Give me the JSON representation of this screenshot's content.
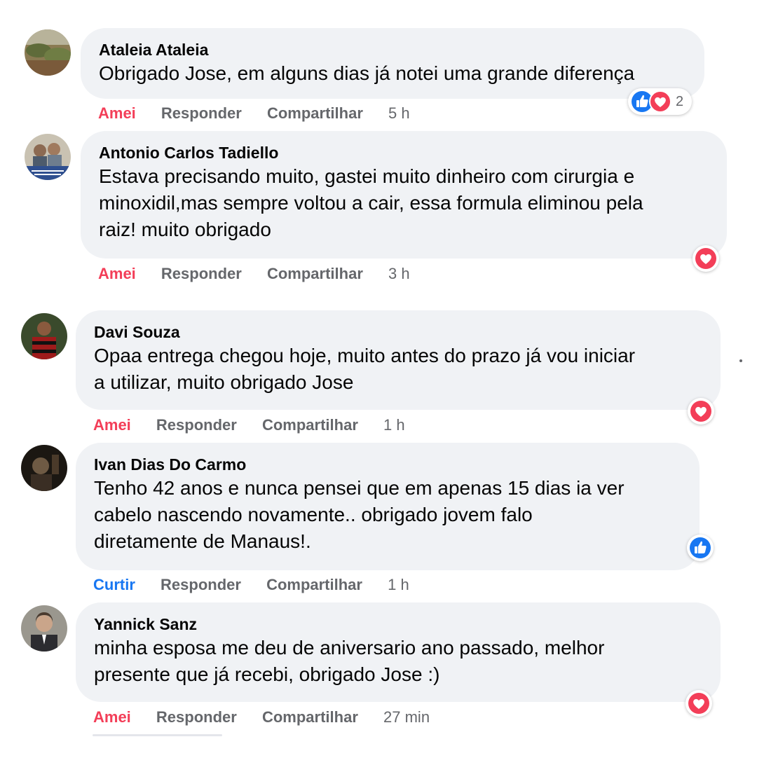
{
  "comments": [
    {
      "author": "Ataleia Ataleia",
      "text_lines": [
        "Obrigado Jose, em alguns dias já notei uma grande diferença"
      ],
      "action_react": "Amei",
      "action_reply": "Responder",
      "action_share": "Compartilhar",
      "time": "5 h",
      "reaction_count": "2",
      "reaction_icons": [
        "like-icon",
        "love-icon"
      ],
      "avatar": "landscape-photo"
    },
    {
      "author": "Antonio Carlos Tadiello",
      "text_lines": [
        "Estava precisando muito, gastei muito dinheiro com cirurgia e",
        "minoxidil,mas sempre voltou a cair, essa formula eliminou pela",
        "raiz! muito obrigado"
      ],
      "action_react": "Amei",
      "action_reply": "Responder",
      "action_share": "Compartilhar",
      "time": "3 h",
      "reaction_icons": [
        "love-icon"
      ],
      "avatar": "family-photo"
    },
    {
      "author": "Davi Souza",
      "text_lines": [
        "Opaa entrega chegou hoje, muito antes do prazo já vou iniciar",
        "a utilizar, muito obrigado Jose"
      ],
      "action_react": "Amei",
      "action_reply": "Responder",
      "action_share": "Compartilhar",
      "time": "1 h",
      "reaction_icons": [
        "love-icon"
      ],
      "avatar": "football-player-photo"
    },
    {
      "author": "Ivan Dias Do Carmo",
      "text_lines": [
        "Tenho 42 anos e nunca pensei que em apenas 15 dias ia ver",
        "cabelo nascendo novamente.. obrigado jovem falo",
        "diretamente de Manaus!."
      ],
      "action_react": "Curtir",
      "action_reply": "Responder",
      "action_share": "Compartilhar",
      "time": "1 h",
      "reaction_icons": [
        "like-icon"
      ],
      "avatar": "dark-portrait-photo"
    },
    {
      "author": "Yannick Sanz",
      "text_lines": [
        "minha esposa me deu de aniversario ano passado, melhor",
        "presente que já recebi, obrigado Jose :)"
      ],
      "action_react": "Amei",
      "action_reply": "Responder",
      "action_share": "Compartilhar",
      "time": "27 min",
      "reaction_icons": [
        "love-icon"
      ],
      "avatar": "suit-portrait-photo"
    }
  ],
  "colors": {
    "bubble": "#f0f2f5",
    "love": "#f33e58",
    "like": "#1877f2",
    "muted": "#65676b"
  }
}
